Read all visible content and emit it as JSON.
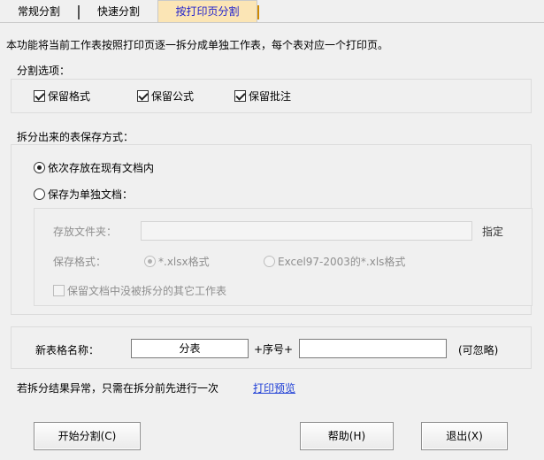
{
  "tabs": [
    {
      "label": "常规分割"
    },
    {
      "label": "快速分割"
    },
    {
      "label": "按打印页分割"
    }
  ],
  "description": "本功能将当前工作表按照打印页逐一拆分成单独工作表，每个表对应一个打印页。",
  "options_section": {
    "title": "分割选项：",
    "keep_format": {
      "label": "保留格式",
      "checked": true
    },
    "keep_formula": {
      "label": "保留公式",
      "checked": true
    },
    "keep_comment": {
      "label": "保留批注",
      "checked": true
    }
  },
  "save_section": {
    "title": "拆分出来的表保存方式：",
    "radio_existing": {
      "label": "依次存放在现有文档内",
      "checked": true
    },
    "radio_separate": {
      "label": "保存为单独文档：",
      "checked": false
    },
    "folder_label": "存放文件夹：",
    "folder_value": "",
    "specify_label": "指定",
    "format_label": "保存格式：",
    "format_xlsx": {
      "label": "*.xlsx格式",
      "checked": true
    },
    "format_xls": {
      "label": "Excel97-2003的*.xls格式",
      "checked": false
    },
    "keep_other": {
      "label": "保留文档中没被拆分的其它工作表",
      "checked": false
    }
  },
  "naming": {
    "label": "新表格名称：",
    "value": "分表",
    "plus_text": "+序号+",
    "suffix_value": "",
    "optional_note": "(可忽略)"
  },
  "footer_note": {
    "text": "若拆分结果异常，只需在拆分前先进行一次",
    "link": "打印预览"
  },
  "buttons": {
    "start": "开始分割(C)",
    "help": "帮助(H)",
    "exit": "退出(X)"
  }
}
